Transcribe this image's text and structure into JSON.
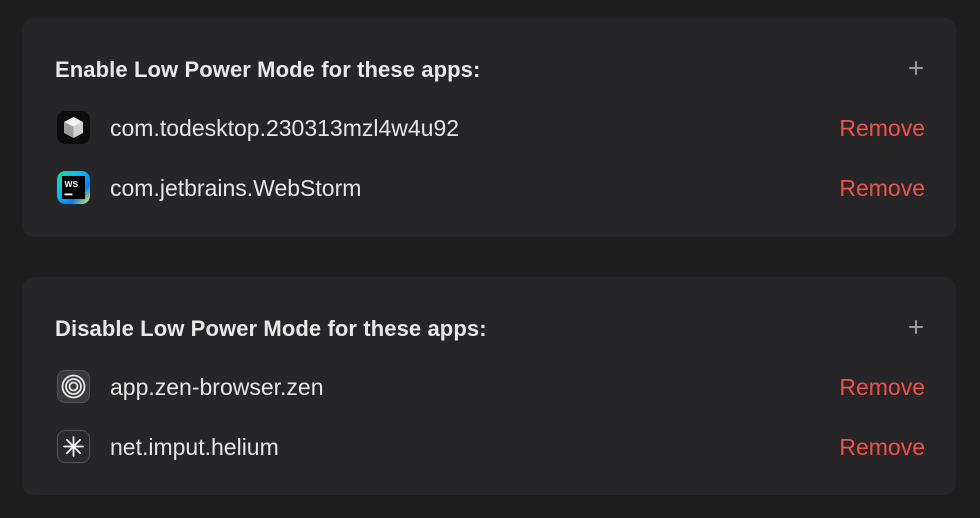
{
  "enable_section": {
    "title": "Enable Low Power Mode for these apps:",
    "add_icon": "plus-icon",
    "apps": [
      {
        "bundle_id": "com.todesktop.230313mzl4w4u92",
        "icon": "todesktop-cube-icon",
        "action": "Remove"
      },
      {
        "bundle_id": "com.jetbrains.WebStorm",
        "icon": "webstorm-icon",
        "action": "Remove"
      }
    ]
  },
  "disable_section": {
    "title": "Disable Low Power Mode for these apps:",
    "add_icon": "plus-icon",
    "apps": [
      {
        "bundle_id": "app.zen-browser.zen",
        "icon": "zen-browser-icon",
        "action": "Remove"
      },
      {
        "bundle_id": "net.imput.helium",
        "icon": "helium-icon",
        "action": "Remove"
      }
    ]
  },
  "colors": {
    "background": "#1e1e1f",
    "panel": "#262628",
    "text": "#e6e6e6",
    "remove_accent": "#f0514b"
  }
}
